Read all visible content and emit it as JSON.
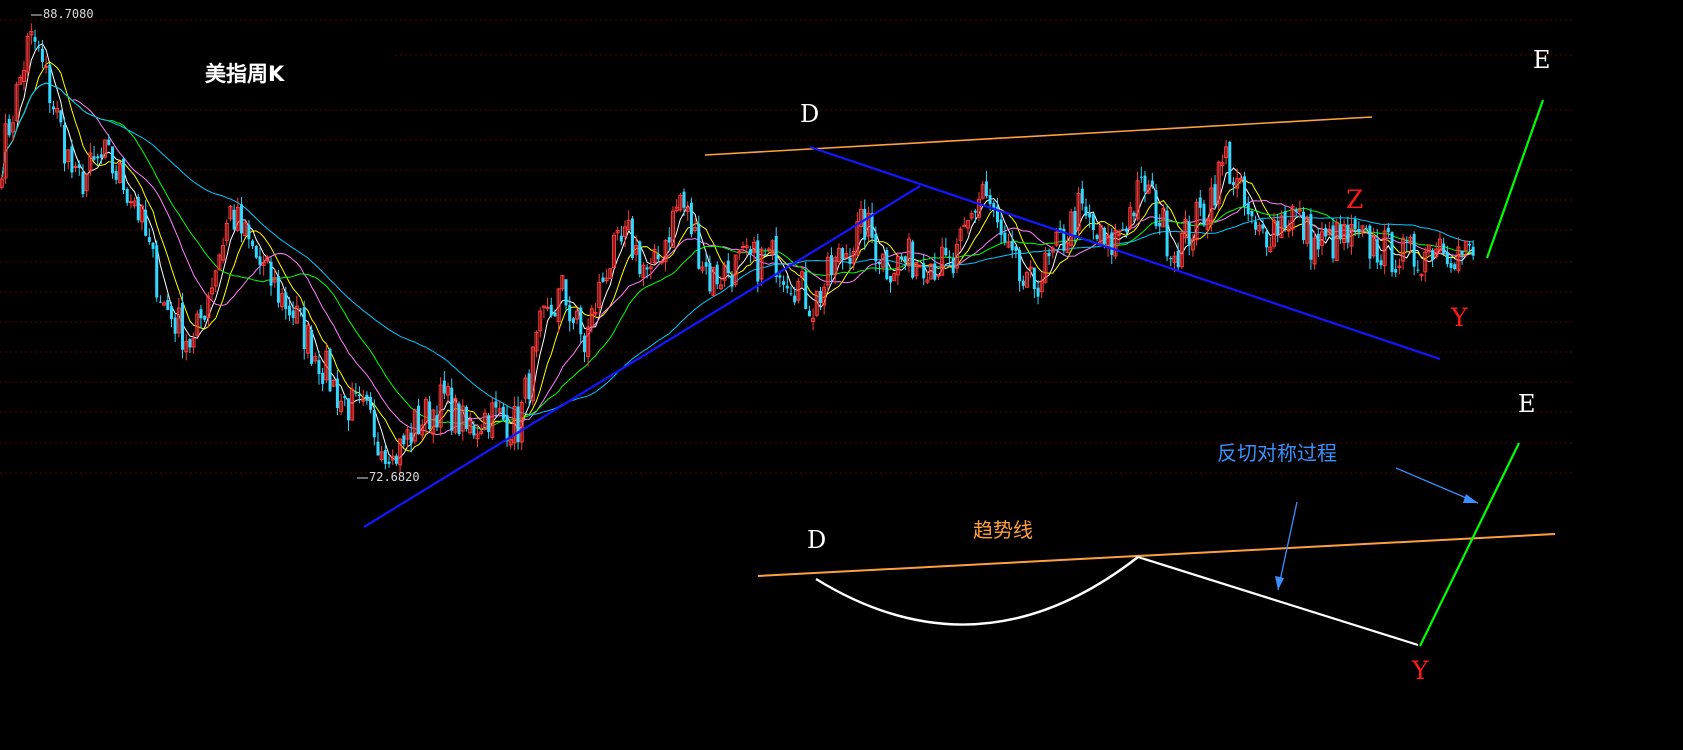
{
  "title": "美指周K",
  "price_max_label": "88.7080",
  "price_min_label": "72.6820",
  "price_axis": {
    "min": 72.0,
    "max": 89.5
  },
  "colors": {
    "up": "#ff3a3a",
    "down": "#32d8ff",
    "ma5": "#ffffff",
    "ma10": "#ffff00",
    "ma20": "#ff80ff",
    "ma30": "#00ff00",
    "ma60": "#00c8ff",
    "trend": "#ffa040",
    "channel": "#1515ff",
    "impulse": "#00ff00",
    "curve": "#ffffff",
    "annot_blue": "#3a90ff",
    "red_label": "#ff1a1a"
  },
  "main_labels": {
    "D": "D",
    "E": "E",
    "Z": "Z",
    "Y": "Y"
  },
  "schematic": {
    "title": "反切对称过程",
    "trend_label": "趋势线",
    "D": "D",
    "E": "E",
    "Y": "Y"
  },
  "chart_data": {
    "type": "candlestick",
    "title": "美指周K",
    "y_range": [
      72.0,
      89.5
    ],
    "high_marker": 88.708,
    "low_marker": 72.682,
    "moving_averages": [
      "MA5",
      "MA10",
      "MA20",
      "MA30",
      "MA60"
    ],
    "close_path": [
      [
        0,
        84.0
      ],
      [
        8,
        88.7
      ],
      [
        14,
        86.0
      ],
      [
        20,
        83.0
      ],
      [
        28,
        84.0
      ],
      [
        36,
        82.5
      ],
      [
        44,
        78.5
      ],
      [
        52,
        77.0
      ],
      [
        58,
        80.0
      ],
      [
        62,
        82.0
      ],
      [
        70,
        80.0
      ],
      [
        80,
        78.0
      ],
      [
        92,
        75.0
      ],
      [
        100,
        74.2
      ],
      [
        106,
        72.7
      ],
      [
        112,
        74.0
      ],
      [
        120,
        75.0
      ],
      [
        126,
        73.8
      ],
      [
        132,
        74.5
      ],
      [
        140,
        74.0
      ],
      [
        146,
        77.5
      ],
      [
        152,
        79.0
      ],
      [
        158,
        77.0
      ],
      [
        164,
        80.0
      ],
      [
        170,
        81.0
      ],
      [
        176,
        79.5
      ],
      [
        184,
        82.5
      ],
      [
        192,
        79.5
      ],
      [
        200,
        80.0
      ],
      [
        210,
        80.3
      ],
      [
        220,
        78.5
      ],
      [
        226,
        80.0
      ],
      [
        234,
        81.5
      ],
      [
        240,
        80.0
      ],
      [
        250,
        80.3
      ],
      [
        258,
        79.8
      ],
      [
        266,
        83.0
      ],
      [
        272,
        80.5
      ],
      [
        278,
        79.0
      ],
      [
        284,
        80.0
      ],
      [
        292,
        82.0
      ],
      [
        300,
        80.5
      ],
      [
        310,
        83.0
      ],
      [
        318,
        80.5
      ],
      [
        326,
        82.0
      ],
      [
        332,
        84.0
      ],
      [
        340,
        81.0
      ],
      [
        350,
        82.0
      ],
      [
        356,
        80.7
      ],
      [
        364,
        81.0
      ],
      [
        372,
        80.7
      ],
      [
        380,
        80.3
      ],
      [
        384,
        80.3
      ],
      [
        390,
        81.0
      ],
      [
        394,
        80.5
      ],
      [
        400,
        80.3
      ]
    ],
    "schematic": {
      "title": "反切对称过程",
      "labels": [
        "D",
        "E",
        "Y",
        "趋势线"
      ]
    }
  }
}
